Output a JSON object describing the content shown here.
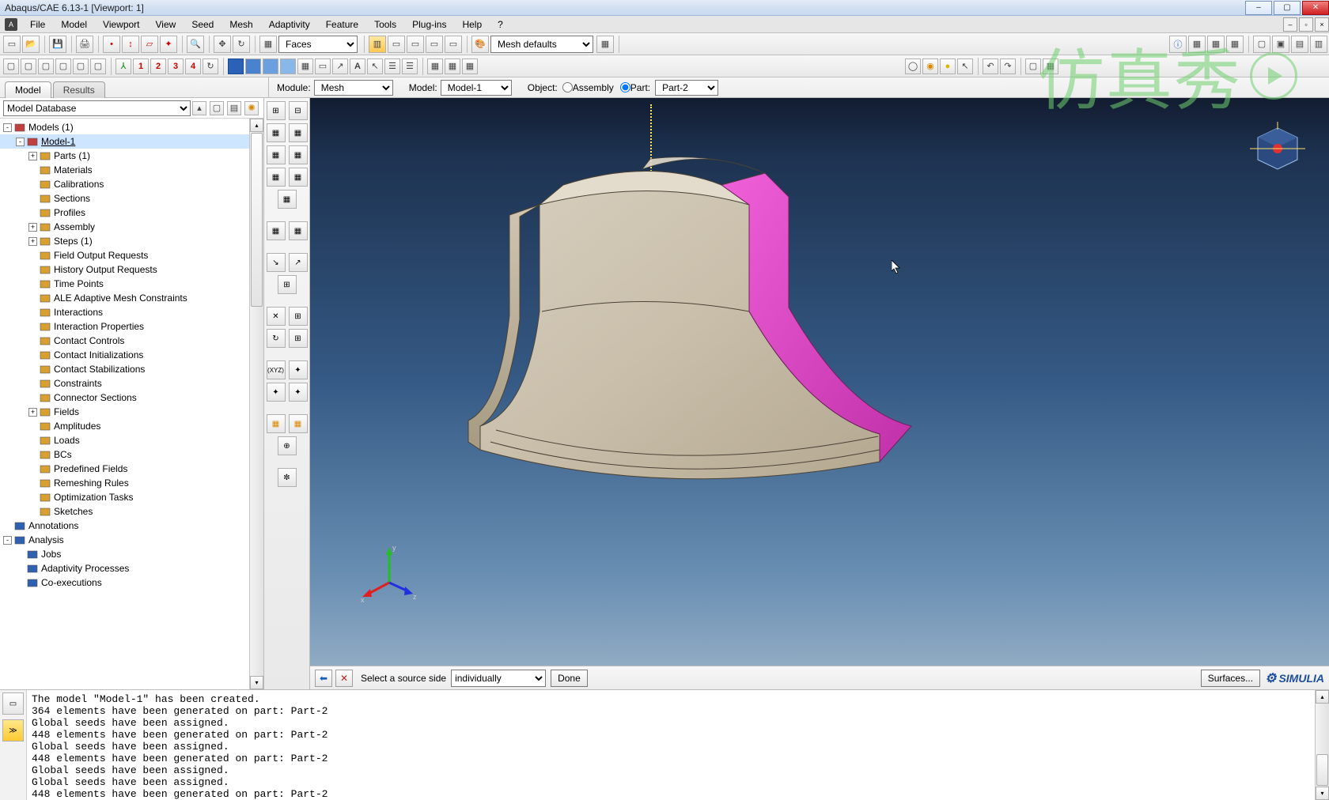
{
  "window": {
    "title": "Abaqus/CAE 6.13-1 [Viewport: 1]"
  },
  "menu": [
    "File",
    "Model",
    "Viewport",
    "View",
    "Seed",
    "Mesh",
    "Adaptivity",
    "Feature",
    "Tools",
    "Plug-ins",
    "Help",
    "?"
  ],
  "toolbar1": {
    "faces_select": "Faces",
    "mesh_defaults": "Mesh defaults"
  },
  "context": {
    "tabs": {
      "model": "Model",
      "results": "Results"
    },
    "module_label": "Module:",
    "module_value": "Mesh",
    "model_label": "Model:",
    "model_value": "Model-1",
    "object_label": "Object:",
    "assembly_label": "Assembly",
    "part_label": "Part:",
    "part_value": "Part-2"
  },
  "sidebar": {
    "db_label": "Model Database"
  },
  "tree": [
    {
      "ind": 0,
      "exp": "-",
      "ic": "#c04040",
      "label": "Models (1)"
    },
    {
      "ind": 1,
      "exp": "-",
      "ic": "#c04040",
      "label": "Model-1",
      "sel": true
    },
    {
      "ind": 2,
      "exp": "+",
      "ic": "#d8a030",
      "label": "Parts (1)"
    },
    {
      "ind": 2,
      "exp": "",
      "ic": "#d8a030",
      "label": "Materials"
    },
    {
      "ind": 2,
      "exp": "",
      "ic": "#d8a030",
      "label": "Calibrations"
    },
    {
      "ind": 2,
      "exp": "",
      "ic": "#d8a030",
      "label": "Sections"
    },
    {
      "ind": 2,
      "exp": "",
      "ic": "#d8a030",
      "label": "Profiles"
    },
    {
      "ind": 2,
      "exp": "+",
      "ic": "#d8a030",
      "label": "Assembly"
    },
    {
      "ind": 2,
      "exp": "+",
      "ic": "#d8a030",
      "label": "Steps (1)"
    },
    {
      "ind": 2,
      "exp": "",
      "ic": "#d8a030",
      "label": "Field Output Requests"
    },
    {
      "ind": 2,
      "exp": "",
      "ic": "#d8a030",
      "label": "History Output Requests"
    },
    {
      "ind": 2,
      "exp": "",
      "ic": "#d8a030",
      "label": "Time Points"
    },
    {
      "ind": 2,
      "exp": "",
      "ic": "#d8a030",
      "label": "ALE Adaptive Mesh Constraints"
    },
    {
      "ind": 2,
      "exp": "",
      "ic": "#d8a030",
      "label": "Interactions"
    },
    {
      "ind": 2,
      "exp": "",
      "ic": "#d8a030",
      "label": "Interaction Properties"
    },
    {
      "ind": 2,
      "exp": "",
      "ic": "#d8a030",
      "label": "Contact Controls"
    },
    {
      "ind": 2,
      "exp": "",
      "ic": "#d8a030",
      "label": "Contact Initializations"
    },
    {
      "ind": 2,
      "exp": "",
      "ic": "#d8a030",
      "label": "Contact Stabilizations"
    },
    {
      "ind": 2,
      "exp": "",
      "ic": "#d8a030",
      "label": "Constraints"
    },
    {
      "ind": 2,
      "exp": "",
      "ic": "#d8a030",
      "label": "Connector Sections"
    },
    {
      "ind": 2,
      "exp": "+",
      "ic": "#d8a030",
      "label": "Fields"
    },
    {
      "ind": 2,
      "exp": "",
      "ic": "#d8a030",
      "label": "Amplitudes"
    },
    {
      "ind": 2,
      "exp": "",
      "ic": "#d8a030",
      "label": "Loads"
    },
    {
      "ind": 2,
      "exp": "",
      "ic": "#d8a030",
      "label": "BCs"
    },
    {
      "ind": 2,
      "exp": "",
      "ic": "#d8a030",
      "label": "Predefined Fields"
    },
    {
      "ind": 2,
      "exp": "",
      "ic": "#d8a030",
      "label": "Remeshing Rules"
    },
    {
      "ind": 2,
      "exp": "",
      "ic": "#d8a030",
      "label": "Optimization Tasks"
    },
    {
      "ind": 2,
      "exp": "",
      "ic": "#d8a030",
      "label": "Sketches"
    },
    {
      "ind": 0,
      "exp": "",
      "ic": "#3060b0",
      "label": "Annotations"
    },
    {
      "ind": 0,
      "exp": "-",
      "ic": "#3060b0",
      "label": "Analysis"
    },
    {
      "ind": 1,
      "exp": "",
      "ic": "#3060b0",
      "label": "Jobs"
    },
    {
      "ind": 1,
      "exp": "",
      "ic": "#3060b0",
      "label": "Adaptivity Processes"
    },
    {
      "ind": 1,
      "exp": "",
      "ic": "#3060b0",
      "label": "Co-executions"
    }
  ],
  "prompt": {
    "text": "Select a source side",
    "select": "individually",
    "done": "Done",
    "surfaces": "Surfaces...",
    "brand": "SIMULIA"
  },
  "messages": "The model \"Model-1\" has been created.\n364 elements have been generated on part: Part-2\nGlobal seeds have been assigned.\n448 elements have been generated on part: Part-2\nGlobal seeds have been assigned.\n448 elements have been generated on part: Part-2\nGlobal seeds have been assigned.\nGlobal seeds have been assigned.\n448 elements have been generated on part: Part-2",
  "watermark": "仿真秀",
  "triad": {
    "x": "x",
    "y": "y",
    "z": "z"
  }
}
